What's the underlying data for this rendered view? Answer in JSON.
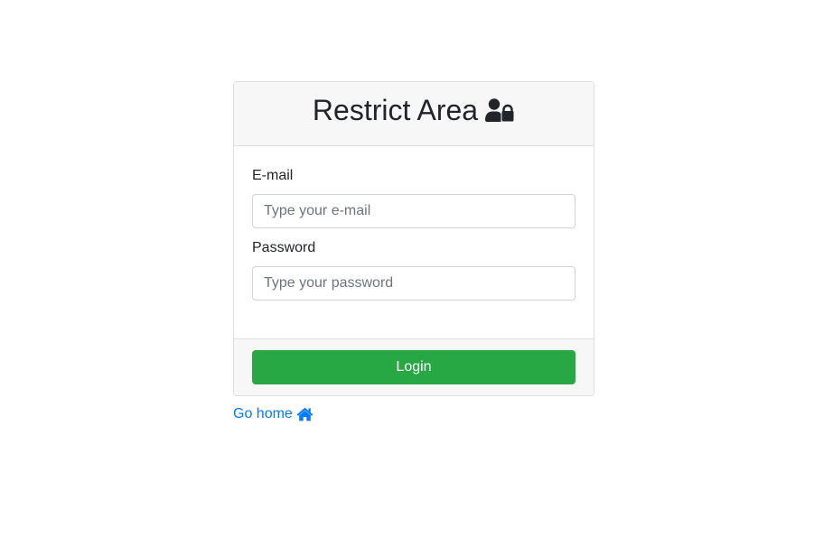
{
  "card": {
    "title": "Restrict Area",
    "title_icon": "user-lock-icon"
  },
  "form": {
    "email": {
      "label": "E-mail",
      "placeholder": "Type your e-mail",
      "value": ""
    },
    "password": {
      "label": "Password",
      "placeholder": "Type your password",
      "value": ""
    },
    "submit_label": "Login"
  },
  "footer_link": {
    "label": "Go home",
    "icon": "home-icon"
  },
  "colors": {
    "accent_button": "#28a745",
    "link": "#007bff",
    "card_header_bg": "#f7f7f7",
    "border": "#dfdfdf"
  }
}
